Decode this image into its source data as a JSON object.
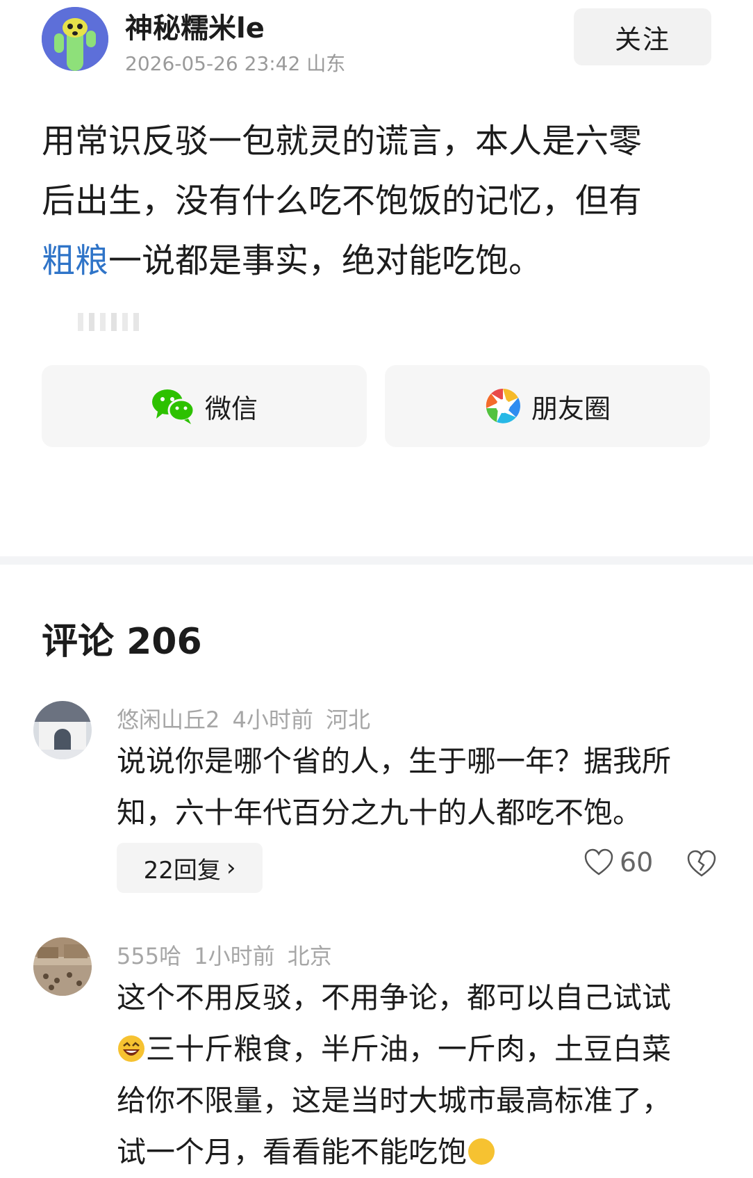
{
  "post": {
    "author": "神秘糯米le",
    "meta": "2026-05-26 23:42 山东",
    "follow_label": "关注",
    "body_line1": "用常识反驳一包就灵的谎言，本人是六零",
    "body_line2": "后出生，没有什么吃不饱饭的记忆，但有",
    "body_tag": "粗粮",
    "body_line3_rest": "一说都是事实，绝对能吃饱。"
  },
  "share": {
    "wechat_label": "微信",
    "moments_label": "朋友圈"
  },
  "comments_header": "评论 206",
  "comments": [
    {
      "meta": "悠闲山丘2 4小时前 河北",
      "text_line1": "说说你是哪个省的人，生于哪一年？据我所",
      "text_line2": "知，六十年代百分之九十的人都吃不饱。",
      "replies_label": "22回复",
      "likes": "60"
    },
    {
      "meta": "555哈 1小时前 北京",
      "text_line1": "这个不用反驳，不用争论，都可以自己试试",
      "text_line2": "三十斤粮食，半斤油，一斤肉，土豆白菜",
      "text_line3": "给你不限量，这是当时大城市最高标准了，",
      "text_line4": "试一个月，看看能不能吃饱"
    }
  ],
  "colors": {
    "accent_link": "#2f74c8",
    "wechat_green": "#2dc100",
    "avatar_bg": "#5d6fd9"
  }
}
